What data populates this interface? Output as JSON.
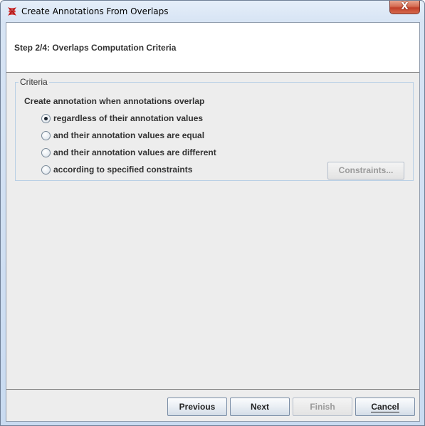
{
  "window": {
    "title": "Create Annotations From Overlaps",
    "close_glyph": "X",
    "app_icon": "gate-x-icon"
  },
  "header": {
    "step_title": "Step 2/4: Overlaps Computation Criteria"
  },
  "criteria": {
    "legend": "Criteria",
    "question": "Create annotation when annotations overlap",
    "options": [
      {
        "label": "regardless of their annotation values",
        "checked": true
      },
      {
        "label": "and their annotation values are equal",
        "checked": false
      },
      {
        "label": "and their annotation values are different",
        "checked": false
      },
      {
        "label": "according to specified constraints",
        "checked": false
      }
    ],
    "constraints_button": "Constraints...",
    "constraints_enabled": false
  },
  "buttons": {
    "previous": "Previous",
    "next": "Next",
    "finish": "Finish",
    "finish_enabled": false,
    "cancel": "Cancel"
  },
  "colors": {
    "app_icon": "#cc2222",
    "close_button": "#c9452e"
  }
}
